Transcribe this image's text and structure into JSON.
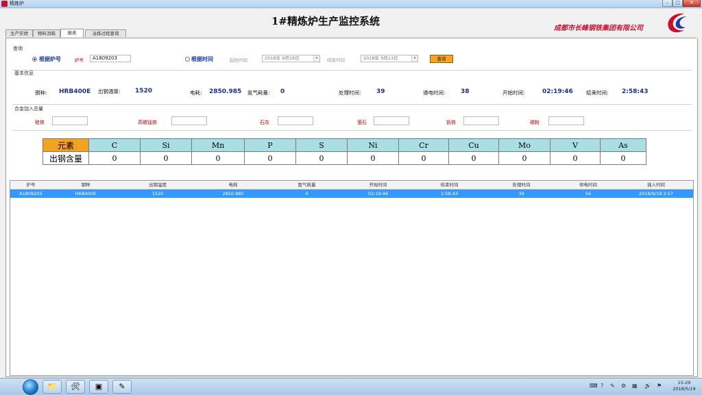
{
  "window": {
    "title": "精炼炉",
    "min": "–",
    "max": "□",
    "close": "✕"
  },
  "header": {
    "title": "1#精炼炉生产监控系统",
    "company": "成都市长峰钢铁集团有限公司"
  },
  "tabs": [
    "生产实绩",
    "物料消耗",
    "报表",
    "冶炼过程查询"
  ],
  "query": {
    "section": "查询",
    "by_furnace": "根据炉号",
    "furnace_label": "炉号",
    "furnace_value": "A1809203",
    "by_time": "根据时间",
    "start_label": "起始时间",
    "start_value": "2018年 9月18日",
    "end_label": "结束时间",
    "end_value": "2018年 9月13日",
    "button": "查询"
  },
  "basic": {
    "section": "基本信息",
    "steel_label": "钢种:",
    "steel_value": "HRB400E",
    "tap_temp_label": "出钢温度:",
    "tap_temp_value": "1520",
    "power_label": "电耗:",
    "power_value": "2850.985",
    "argon_label": "氩气耗量:",
    "argon_value": "0",
    "proc_time_label": "处理时间:",
    "proc_time_value": "39",
    "power_on_label": "通电时间:",
    "power_on_value": "38",
    "start_label": "开始时间:",
    "start_value": "02:19:46",
    "end_label": "结束时间:",
    "end_value": "2:58:43"
  },
  "alloy": {
    "section": "合金加入总量",
    "items": [
      "硅铁",
      "高碳锰铁",
      "石灰",
      "萤石",
      "钒铁",
      "碳粉"
    ]
  },
  "elements": {
    "header": "元素",
    "row_label": "出钢含量",
    "names": [
      "C",
      "Si",
      "Mn",
      "P",
      "S",
      "Ni",
      "Cr",
      "Cu",
      "Mo",
      "V",
      "As"
    ],
    "values": [
      "0",
      "0",
      "0",
      "0",
      "0",
      "0",
      "0",
      "0",
      "0",
      "0",
      "0"
    ]
  },
  "grid": {
    "columns": [
      "炉号",
      "钢种",
      "出钢温度",
      "电耗",
      "氩气耗量",
      "开始时间",
      "结束时间",
      "处理时间",
      "供电时间",
      "插入时间"
    ],
    "rows": [
      [
        "A1809203",
        "HRB400E",
        "1520",
        "2850.985",
        "0",
        "02:19:46",
        "2:58:43",
        "39",
        "56",
        "2018/9/18 2:57"
      ]
    ]
  },
  "taskbar": {
    "time": "15:29",
    "date": "2018/5/19"
  }
}
